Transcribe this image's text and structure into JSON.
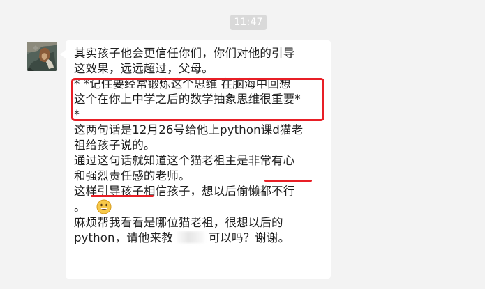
{
  "chat": {
    "timestamp": "11:47",
    "message": {
      "lines": [
        "其实孩子他会更信任你们，你们对他的引导",
        "这效果，远远超过，父母。",
        "*  *记住要经常锻炼这个思维 在脑海中回想",
        "这个在你上中学之后的数学抽象思维很重要*",
        "*",
        "这两句话是12月26号给他上python课d猫老",
        "祖给孩子说的。",
        "通过这句话就知道这个猫老祖主是非常有心",
        "和强烈责任感的老师。",
        "这样引导孩子相信孩子，想以后偷懒都不行",
        "。",
        "麻烦帮我看看是哪位猫老祖，很想以后的",
        "python，请他来教",
        "可以吗？谢谢。"
      ]
    }
  },
  "icons": {
    "emoji": "grinning-face-emoji",
    "avatar": "user-avatar-photo"
  },
  "colors": {
    "background": "#f3f3f3",
    "bubble": "#ffffff",
    "timestamp_bg": "#d9d9d9",
    "annotation_red": "#e81f26"
  }
}
